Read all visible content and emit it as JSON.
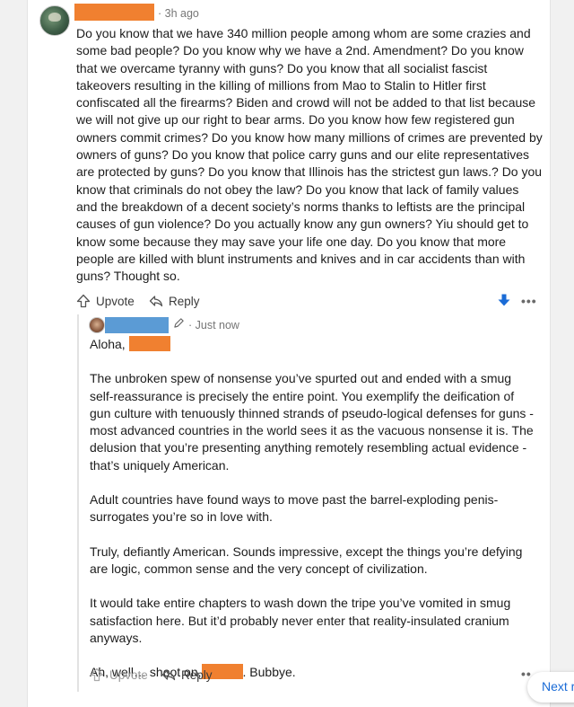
{
  "comment": {
    "time": "· 3h ago",
    "body": "Do you know that we have 340 million people among whom are some crazies and some bad people? Do you know why we have a 2nd. Amendment? Do you know that we overcame tyranny with guns? Do you know that all socialist fascist takeovers resulting in the killing of millions from Mao to Stalin to Hitler first confiscated all the firearms? Biden and crowd will not be added to that list because we will not give up our right to bear arms. Do you know how few registered gun owners commit crimes? Do you know how many millions of crimes are prevented by owners of guns? Do you know that police carry guns and our elite representatives are protected by guns? Do you know that Illinois has the strictest gun laws.? Do you know that criminals do not obey the law? Do you know that lack of family values and the breakdown of a decent society’s norms thanks to leftists are the principal causes of gun violence? Do you actually know any gun owners? Yiu should get to know some because they may save your life one day. Do you know that more people are killed with blunt instruments and knives and in car accidents than with guns? Thought so.",
    "upvote_label": "Upvote",
    "reply_label": "Reply",
    "more_glyph": "•••"
  },
  "reply": {
    "time": "· Just now",
    "greeting": "Aloha,",
    "paragraphs": [
      "The unbroken spew of nonsense you’ve spurted out and ended with a smug self-reassurance is precisely the entire point. You exemplify the deification of gun culture with tenuously thinned strands of pseudo-logical defenses for guns - most advanced countries in the world sees it as the vacuous nonsense it is. The delusion that you’re presenting anything remotely resembling actual evidence - that’s uniquely American.",
      "Adult countries have found ways to move past the barrel-exploding penis-surrogates you’re so in love with.",
      "Truly, defiantly American. Sounds impressive, except the things you’re defying are logic, common sense and the very concept of civilization.",
      "It would take entire chapters to wash down the tripe you’ve vomited in smug satisfaction here. But it’d probably never enter that reality-insulated cranium anyways."
    ],
    "closing_start": "Ah, well… shoot on,",
    "closing_end": ". Bubbye.",
    "upvote_label": "Upvote",
    "reply_label": "Reply",
    "more_glyph": "••"
  },
  "next_button": {
    "label": "Next r"
  },
  "colors": {
    "redaction_orange": "#f08030",
    "redaction_blue": "#5b9bd5",
    "downvote_blue": "#1a6bd6"
  }
}
